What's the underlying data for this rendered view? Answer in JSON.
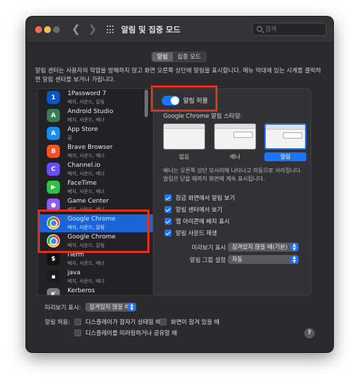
{
  "window": {
    "title": "알림 및 집중 모드",
    "search_placeholder": "검색"
  },
  "tabs": [
    {
      "label": "알림",
      "active": true
    },
    {
      "label": "집중 모드",
      "active": false
    }
  ],
  "description": "알림 센터는 사용자의 작업을 방해하지 않고 화면 오른쪽 상단에 알림을 표시합니다. 메뉴 막대에 있는 시계를 클릭하면 알림 센터를 보거나 가립니다.",
  "apps": [
    {
      "name": "1Password 7",
      "sub": "배지, 사운드, 알림",
      "icon": "onepassword-icon",
      "color": "#0a57c2",
      "glyph": "1"
    },
    {
      "name": "Android Studio",
      "sub": "배지, 사운드, 배너",
      "icon": "android-studio-icon",
      "color": "#3c7d54",
      "glyph": "A"
    },
    {
      "name": "App Store",
      "sub": "끔",
      "icon": "app-store-icon",
      "color": "#1a8cf0",
      "glyph": "A"
    },
    {
      "name": "Brave Browser",
      "sub": "배지, 사운드, 배너",
      "icon": "brave-icon",
      "color": "#f05523",
      "glyph": "B"
    },
    {
      "name": "Channel.io",
      "sub": "배지, 사운드, 배너",
      "icon": "channel-io-icon",
      "color": "#6b4ff2",
      "glyph": "C"
    },
    {
      "name": "FaceTime",
      "sub": "배지, 사운드, 배너",
      "icon": "facetime-icon",
      "color": "#2fbf4a",
      "glyph": "▶"
    },
    {
      "name": "Game Center",
      "sub": "배지, 사운드, 배너",
      "icon": "game-center-icon",
      "color": "#8a5cf0",
      "glyph": "●"
    },
    {
      "name": "Google Chrome",
      "sub": "배지, 사운드, 알림",
      "icon": "chrome-icon",
      "color": "chrome",
      "glyph": ""
    },
    {
      "name": "Google Chrome",
      "sub": "배지, 사운드, 알림",
      "icon": "chrome-icon",
      "color": "chrome",
      "glyph": ""
    },
    {
      "name": "iTerm",
      "sub": "배지, 사운드, 배너",
      "icon": "iterm-icon",
      "color": "#111111",
      "glyph": "$"
    },
    {
      "name": "java",
      "sub": "배지, 사운드, 배너",
      "icon": "java-icon",
      "color": "#1c1c1c",
      "glyph": "▪"
    },
    {
      "name": "Kerberos",
      "sub": "배지, 사운드, 배너",
      "icon": "kerberos-icon",
      "color": "#7a7a7a",
      "glyph": "K"
    }
  ],
  "settings": {
    "allow_label": "알림 허용",
    "allow_on": true,
    "style_label": "Google Chrome 알림 스타일:",
    "styles": [
      {
        "label": "없음",
        "selected": false
      },
      {
        "label": "배너",
        "selected": false
      },
      {
        "label": "알림",
        "selected": true
      }
    ],
    "style_description": "배너는 오른쪽 상단 모서리에 나타나고 자동으로 사라집니다. 알림은 닫을 때까지 화면에 계속 표시됩니다.",
    "checkboxes": [
      {
        "label": "잠금 화면에서 알림 보기",
        "checked": true
      },
      {
        "label": "알림 센터에서 보기",
        "checked": true
      },
      {
        "label": "앱 아이콘에 배지 표시",
        "checked": true
      },
      {
        "label": "알림 사운드 재생",
        "checked": true
      }
    ],
    "preview_label": "미리보기 표시",
    "preview_value": "잠겨있지 않을 때(기본)",
    "grouping_label": "알림 그룹 설정",
    "grouping_value": "자동"
  },
  "bottom": {
    "preview_label": "미리보기 표시:",
    "preview_value": "잠겨있지 않을 때",
    "allow_label": "알림 허용:",
    "options": [
      {
        "label": "디스플레이가 잠자기 상태일 때",
        "checked": false
      },
      {
        "label": "화면이 잠겨 있을 때",
        "checked": false
      },
      {
        "label": "디스플레이를 미러링하거나 공유할 때",
        "checked": false
      }
    ]
  },
  "help_glyph": "?"
}
